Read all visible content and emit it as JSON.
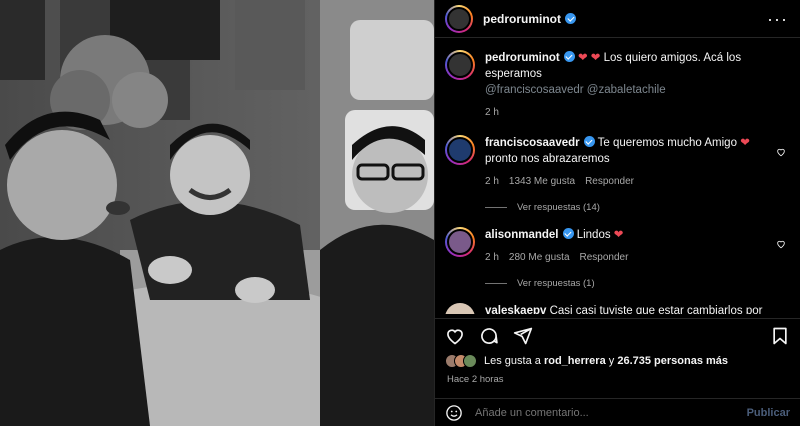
{
  "header": {
    "username": "pedroruminot",
    "more_label": "···"
  },
  "caption": {
    "username": "pedroruminot",
    "text": "Los quiero amigos. Acá los esperamos",
    "mentions": "@franciscosaavedr @zabaletachile",
    "time": "2 h"
  },
  "comments": [
    {
      "username": "franciscosaavedr",
      "text_before": "Te queremos mucho Amigo",
      "text_after": "pronto nos abrazaremos",
      "time": "2 h",
      "likes": "1343 Me gusta",
      "reply": "Responder",
      "view_replies": "Ver respuestas (14)"
    },
    {
      "username": "alisonmandel",
      "text_before": "Lindos",
      "text_after": "",
      "time": "2 h",
      "likes": "280 Me gusta",
      "reply": "Responder",
      "view_replies": "Ver respuestas (1)"
    },
    {
      "username": "valeskaepv",
      "text_before": "Casi casi tuviste que estar cambiarlos por Renato Munster y Pancho del Sur",
      "text_after": ""
    }
  ],
  "likes": {
    "prefix": "Les gusta a",
    "user": "rod_herrera",
    "conj": "y",
    "count": "26.735 personas más"
  },
  "post_time": "Hace 2 horas",
  "add_comment": {
    "placeholder": "Añade un comentario...",
    "post_label": "Publicar"
  },
  "colors": {
    "heart": "#ed4956",
    "verified": "#3897f0",
    "background": "#000000"
  }
}
